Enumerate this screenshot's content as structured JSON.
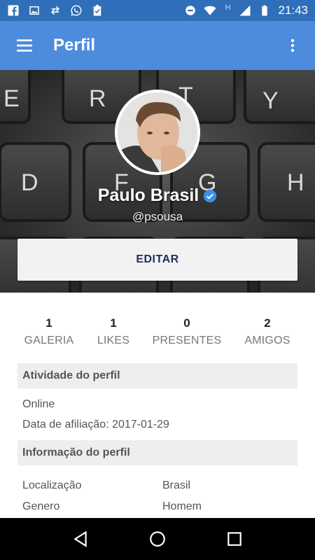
{
  "status_bar": {
    "time": "21:43",
    "left_icons": [
      "facebook-icon",
      "image-icon",
      "sync-icon",
      "whatsapp-icon",
      "clipboard-check-icon"
    ],
    "right_icons": [
      "do-not-disturb-icon",
      "wifi-icon",
      "h-network-icon",
      "cellular-signal-icon",
      "battery-icon"
    ],
    "network_label": "H"
  },
  "app_bar": {
    "title": "Perfil"
  },
  "profile": {
    "name": "Paulo Brasil",
    "username": "@psousa",
    "verified": true,
    "edit_label": "EDITAR"
  },
  "stats": [
    {
      "value": "1",
      "label": "GALERIA"
    },
    {
      "value": "1",
      "label": "LIKES"
    },
    {
      "value": "0",
      "label": "PRESENTES"
    },
    {
      "value": "2",
      "label": "AMIGOS"
    }
  ],
  "activity": {
    "header": "Atividade do perfil",
    "status": "Online",
    "joined": "Data de afiliação: 2017-01-29"
  },
  "info": {
    "header": "Informação do perfil",
    "rows": [
      {
        "label": "Localização",
        "value": "Brasil"
      },
      {
        "label": "Genero",
        "value": "Homem"
      }
    ]
  },
  "colors": {
    "status_bar": "#2f6fb9",
    "app_bar": "#4d8bdc",
    "verified": "#3b8fe8"
  }
}
